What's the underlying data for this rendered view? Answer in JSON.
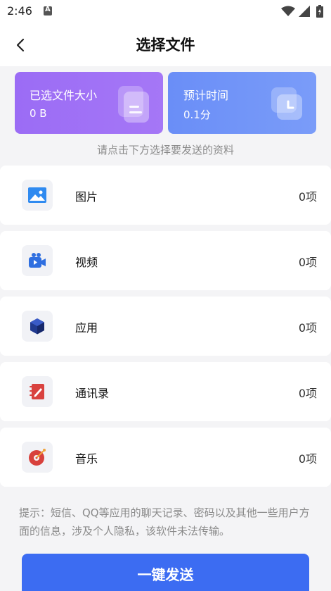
{
  "status_bar": {
    "time": "2:46"
  },
  "header": {
    "title": "选择文件"
  },
  "cards": {
    "size": {
      "label": "已选文件大小",
      "value": "0 B"
    },
    "time": {
      "label": "预计时间",
      "value": "0.1分"
    }
  },
  "hint": "请点击下方选择要发送的资料",
  "items": [
    {
      "label": "图片",
      "count": "0项",
      "icon": "image-icon"
    },
    {
      "label": "视频",
      "count": "0项",
      "icon": "video-icon"
    },
    {
      "label": "应用",
      "count": "0项",
      "icon": "app-icon"
    },
    {
      "label": "通讯录",
      "count": "0项",
      "icon": "contacts-icon"
    },
    {
      "label": "音乐",
      "count": "0项",
      "icon": "music-icon"
    }
  ],
  "tip": "提示：短信、QQ等应用的聊天记录、密码以及其他一些用户方面的信息，涉及个人隐私，该软件未法传输。",
  "send_button": "一键发送",
  "colors": {
    "accent": "#3c6cf2",
    "card_purple": "#9b6cf5",
    "card_blue": "#6a8ef7"
  }
}
